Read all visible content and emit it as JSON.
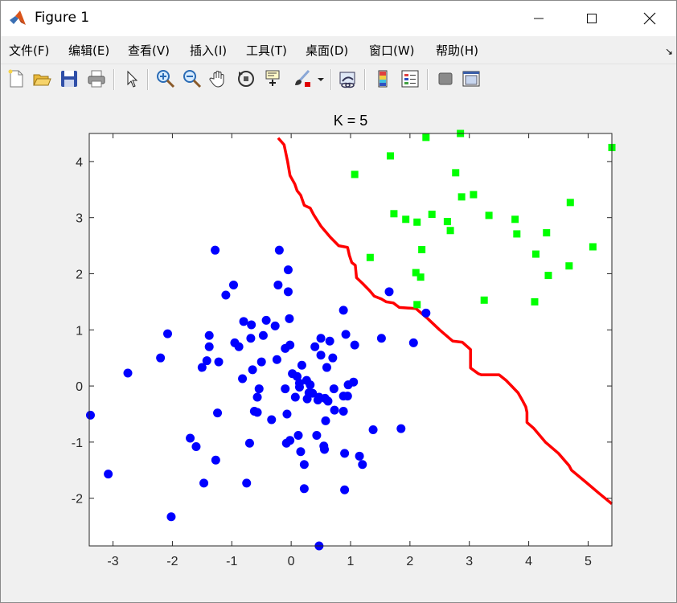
{
  "window": {
    "title": "Figure 1"
  },
  "menu": [
    {
      "label": "文件(F)"
    },
    {
      "label": "编辑(E)"
    },
    {
      "label": "查看(V)"
    },
    {
      "label": "插入(I)"
    },
    {
      "label": "工具(T)"
    },
    {
      "label": "桌面(D)"
    },
    {
      "label": "窗口(W)"
    },
    {
      "label": "帮助(H)"
    }
  ],
  "toolbar": [
    {
      "icon": "new-figure-icon"
    },
    {
      "icon": "open-file-icon"
    },
    {
      "icon": "save-icon"
    },
    {
      "icon": "print-icon"
    },
    {
      "icon": "edit-plot-arrow-icon"
    },
    {
      "icon": "zoom-in-icon"
    },
    {
      "icon": "zoom-out-icon"
    },
    {
      "icon": "pan-hand-icon"
    },
    {
      "icon": "rotate-3d-icon"
    },
    {
      "icon": "data-cursor-icon"
    },
    {
      "icon": "brush-icon"
    },
    {
      "icon": "brush-dropdown-icon"
    },
    {
      "icon": "link-plot-icon"
    },
    {
      "icon": "colorbar-icon"
    },
    {
      "icon": "legend-icon"
    },
    {
      "icon": "hide-plot-tools-icon"
    },
    {
      "icon": "show-plot-tools-icon"
    }
  ],
  "colors": {
    "class1": "#0000ff",
    "class2": "#00ff00",
    "boundary": "#ff0000"
  },
  "chart_data": {
    "type": "scatter",
    "title": "K = 5",
    "xlim": [
      -3.4,
      5.4
    ],
    "ylim": [
      -2.85,
      4.5
    ],
    "xticks": [
      -3,
      -2,
      -1,
      0,
      1,
      2,
      3,
      4,
      5
    ],
    "yticks": [
      -2,
      -1,
      0,
      1,
      2,
      3,
      4
    ],
    "xtick_labels": [
      "-3",
      "-2",
      "-1",
      "0",
      "1",
      "2",
      "3",
      "4",
      "5"
    ],
    "ytick_labels": [
      "-2",
      "-1",
      "0",
      "1",
      "2",
      "3",
      "4"
    ],
    "grid": false,
    "series": [
      {
        "marker": "circle",
        "color": "#0000ff",
        "points": [
          [
            -3.38,
            -0.52
          ],
          [
            -3.08,
            -1.57
          ],
          [
            -2.75,
            0.23
          ],
          [
            -2.2,
            0.5
          ],
          [
            -2.08,
            0.93
          ],
          [
            -2.02,
            -2.33
          ],
          [
            -1.7,
            -0.93
          ],
          [
            -1.6,
            -1.08
          ],
          [
            -1.5,
            0.33
          ],
          [
            -1.47,
            -1.73
          ],
          [
            -1.42,
            0.45
          ],
          [
            -1.38,
            0.7
          ],
          [
            -1.38,
            0.9
          ],
          [
            -1.28,
            2.42
          ],
          [
            -1.27,
            -1.32
          ],
          [
            -1.24,
            -0.48
          ],
          [
            -1.22,
            0.43
          ],
          [
            -1.1,
            1.62
          ],
          [
            -0.97,
            1.8
          ],
          [
            -0.95,
            0.77
          ],
          [
            -0.88,
            0.7
          ],
          [
            -0.82,
            0.13
          ],
          [
            -0.8,
            1.15
          ],
          [
            -0.75,
            -1.73
          ],
          [
            -0.7,
            -1.02
          ],
          [
            -0.68,
            0.85
          ],
          [
            -0.67,
            1.09
          ],
          [
            -0.65,
            0.29
          ],
          [
            -0.62,
            -0.45
          ],
          [
            -0.57,
            -0.2
          ],
          [
            -0.57,
            -0.47
          ],
          [
            -0.54,
            -0.05
          ],
          [
            -0.5,
            0.43
          ],
          [
            -0.47,
            0.9
          ],
          [
            -0.42,
            1.17
          ],
          [
            -0.33,
            -0.6
          ],
          [
            -0.27,
            1.07
          ],
          [
            -0.24,
            0.47
          ],
          [
            -0.22,
            1.8
          ],
          [
            -0.2,
            2.42
          ],
          [
            -0.1,
            0.67
          ],
          [
            -0.1,
            -0.05
          ],
          [
            -0.08,
            -1.02
          ],
          [
            -0.07,
            -0.5
          ],
          [
            -0.05,
            2.07
          ],
          [
            -0.05,
            1.68
          ],
          [
            -0.03,
            1.2
          ],
          [
            -0.02,
            -0.97
          ],
          [
            -0.02,
            0.73
          ],
          [
            0.02,
            0.22
          ],
          [
            0.07,
            -0.2
          ],
          [
            0.1,
            0.17
          ],
          [
            0.12,
            -0.88
          ],
          [
            0.14,
            0.05
          ],
          [
            0.14,
            -0.02
          ],
          [
            0.16,
            -1.17
          ],
          [
            0.18,
            0.37
          ],
          [
            0.22,
            -1.83
          ],
          [
            0.22,
            -1.4
          ],
          [
            0.26,
            0.1
          ],
          [
            0.27,
            -0.23
          ],
          [
            0.3,
            -0.12
          ],
          [
            0.32,
            0.02
          ],
          [
            0.36,
            -0.13
          ],
          [
            0.4,
            0.7
          ],
          [
            0.43,
            -0.88
          ],
          [
            0.45,
            -0.25
          ],
          [
            0.47,
            -0.2
          ],
          [
            0.47,
            -2.85
          ],
          [
            0.5,
            0.85
          ],
          [
            0.5,
            0.55
          ],
          [
            0.55,
            -1.07
          ],
          [
            0.57,
            -0.22
          ],
          [
            0.56,
            -1.13
          ],
          [
            0.58,
            -0.62
          ],
          [
            0.6,
            0.33
          ],
          [
            0.62,
            -0.27
          ],
          [
            0.65,
            0.8
          ],
          [
            0.7,
            0.5
          ],
          [
            0.72,
            -0.05
          ],
          [
            0.73,
            -0.43
          ],
          [
            0.88,
            1.35
          ],
          [
            0.88,
            -0.18
          ],
          [
            0.88,
            -0.45
          ],
          [
            0.9,
            -1.2
          ],
          [
            0.9,
            -1.85
          ],
          [
            0.92,
            0.92
          ],
          [
            0.95,
            -0.18
          ],
          [
            0.96,
            0.02
          ],
          [
            1.05,
            0.07
          ],
          [
            1.07,
            0.73
          ],
          [
            1.15,
            -1.25
          ],
          [
            1.2,
            -1.4
          ],
          [
            1.38,
            -0.78
          ],
          [
            1.52,
            0.85
          ],
          [
            1.65,
            1.68
          ],
          [
            1.85,
            -0.76
          ],
          [
            2.06,
            0.77
          ],
          [
            2.27,
            1.3
          ]
        ]
      },
      {
        "marker": "square",
        "color": "#00ff00",
        "points": [
          [
            1.07,
            3.77
          ],
          [
            1.33,
            2.29
          ],
          [
            1.67,
            4.1
          ],
          [
            1.73,
            3.07
          ],
          [
            1.93,
            2.97
          ],
          [
            2.1,
            2.02
          ],
          [
            2.12,
            2.92
          ],
          [
            2.12,
            1.45
          ],
          [
            2.18,
            1.94
          ],
          [
            2.2,
            2.43
          ],
          [
            2.27,
            4.43
          ],
          [
            2.37,
            3.06
          ],
          [
            2.63,
            2.93
          ],
          [
            2.68,
            2.77
          ],
          [
            2.77,
            3.8
          ],
          [
            2.85,
            4.5
          ],
          [
            2.87,
            3.37
          ],
          [
            3.07,
            3.41
          ],
          [
            3.25,
            1.53
          ],
          [
            3.33,
            3.04
          ],
          [
            3.77,
            2.97
          ],
          [
            3.8,
            2.71
          ],
          [
            4.1,
            1.5
          ],
          [
            4.12,
            2.35
          ],
          [
            4.3,
            2.73
          ],
          [
            4.33,
            1.97
          ],
          [
            4.68,
            2.14
          ],
          [
            4.7,
            3.27
          ],
          [
            5.08,
            2.48
          ],
          [
            5.4,
            4.25
          ]
        ]
      }
    ],
    "boundary": {
      "color": "#ff0000",
      "points": [
        [
          -0.22,
          4.42
        ],
        [
          -0.12,
          4.3
        ],
        [
          -0.06,
          4.0
        ],
        [
          -0.02,
          3.75
        ],
        [
          0.06,
          3.6
        ],
        [
          0.1,
          3.48
        ],
        [
          0.16,
          3.4
        ],
        [
          0.22,
          3.22
        ],
        [
          0.32,
          3.17
        ],
        [
          0.38,
          3.05
        ],
        [
          0.5,
          2.85
        ],
        [
          0.66,
          2.65
        ],
        [
          0.8,
          2.5
        ],
        [
          0.95,
          2.47
        ],
        [
          0.98,
          2.33
        ],
        [
          1.02,
          2.2
        ],
        [
          1.08,
          2.15
        ],
        [
          1.1,
          1.93
        ],
        [
          1.2,
          1.83
        ],
        [
          1.32,
          1.7
        ],
        [
          1.4,
          1.6
        ],
        [
          1.52,
          1.55
        ],
        [
          1.6,
          1.5
        ],
        [
          1.72,
          1.48
        ],
        [
          1.82,
          1.4
        ],
        [
          2.1,
          1.38
        ],
        [
          2.3,
          1.2
        ],
        [
          2.5,
          1.0
        ],
        [
          2.72,
          0.8
        ],
        [
          2.88,
          0.78
        ],
        [
          3.02,
          0.65
        ],
        [
          3.02,
          0.32
        ],
        [
          3.15,
          0.22
        ],
        [
          3.2,
          0.2
        ],
        [
          3.5,
          0.2
        ],
        [
          3.62,
          0.1
        ],
        [
          3.82,
          -0.12
        ],
        [
          3.9,
          -0.27
        ],
        [
          3.95,
          -0.37
        ],
        [
          3.97,
          -0.47
        ],
        [
          3.97,
          -0.65
        ],
        [
          4.08,
          -0.75
        ],
        [
          4.28,
          -1.0
        ],
        [
          4.5,
          -1.2
        ],
        [
          4.68,
          -1.42
        ],
        [
          4.72,
          -1.5
        ],
        [
          4.97,
          -1.72
        ],
        [
          5.17,
          -1.9
        ],
        [
          5.4,
          -2.1
        ]
      ]
    }
  }
}
